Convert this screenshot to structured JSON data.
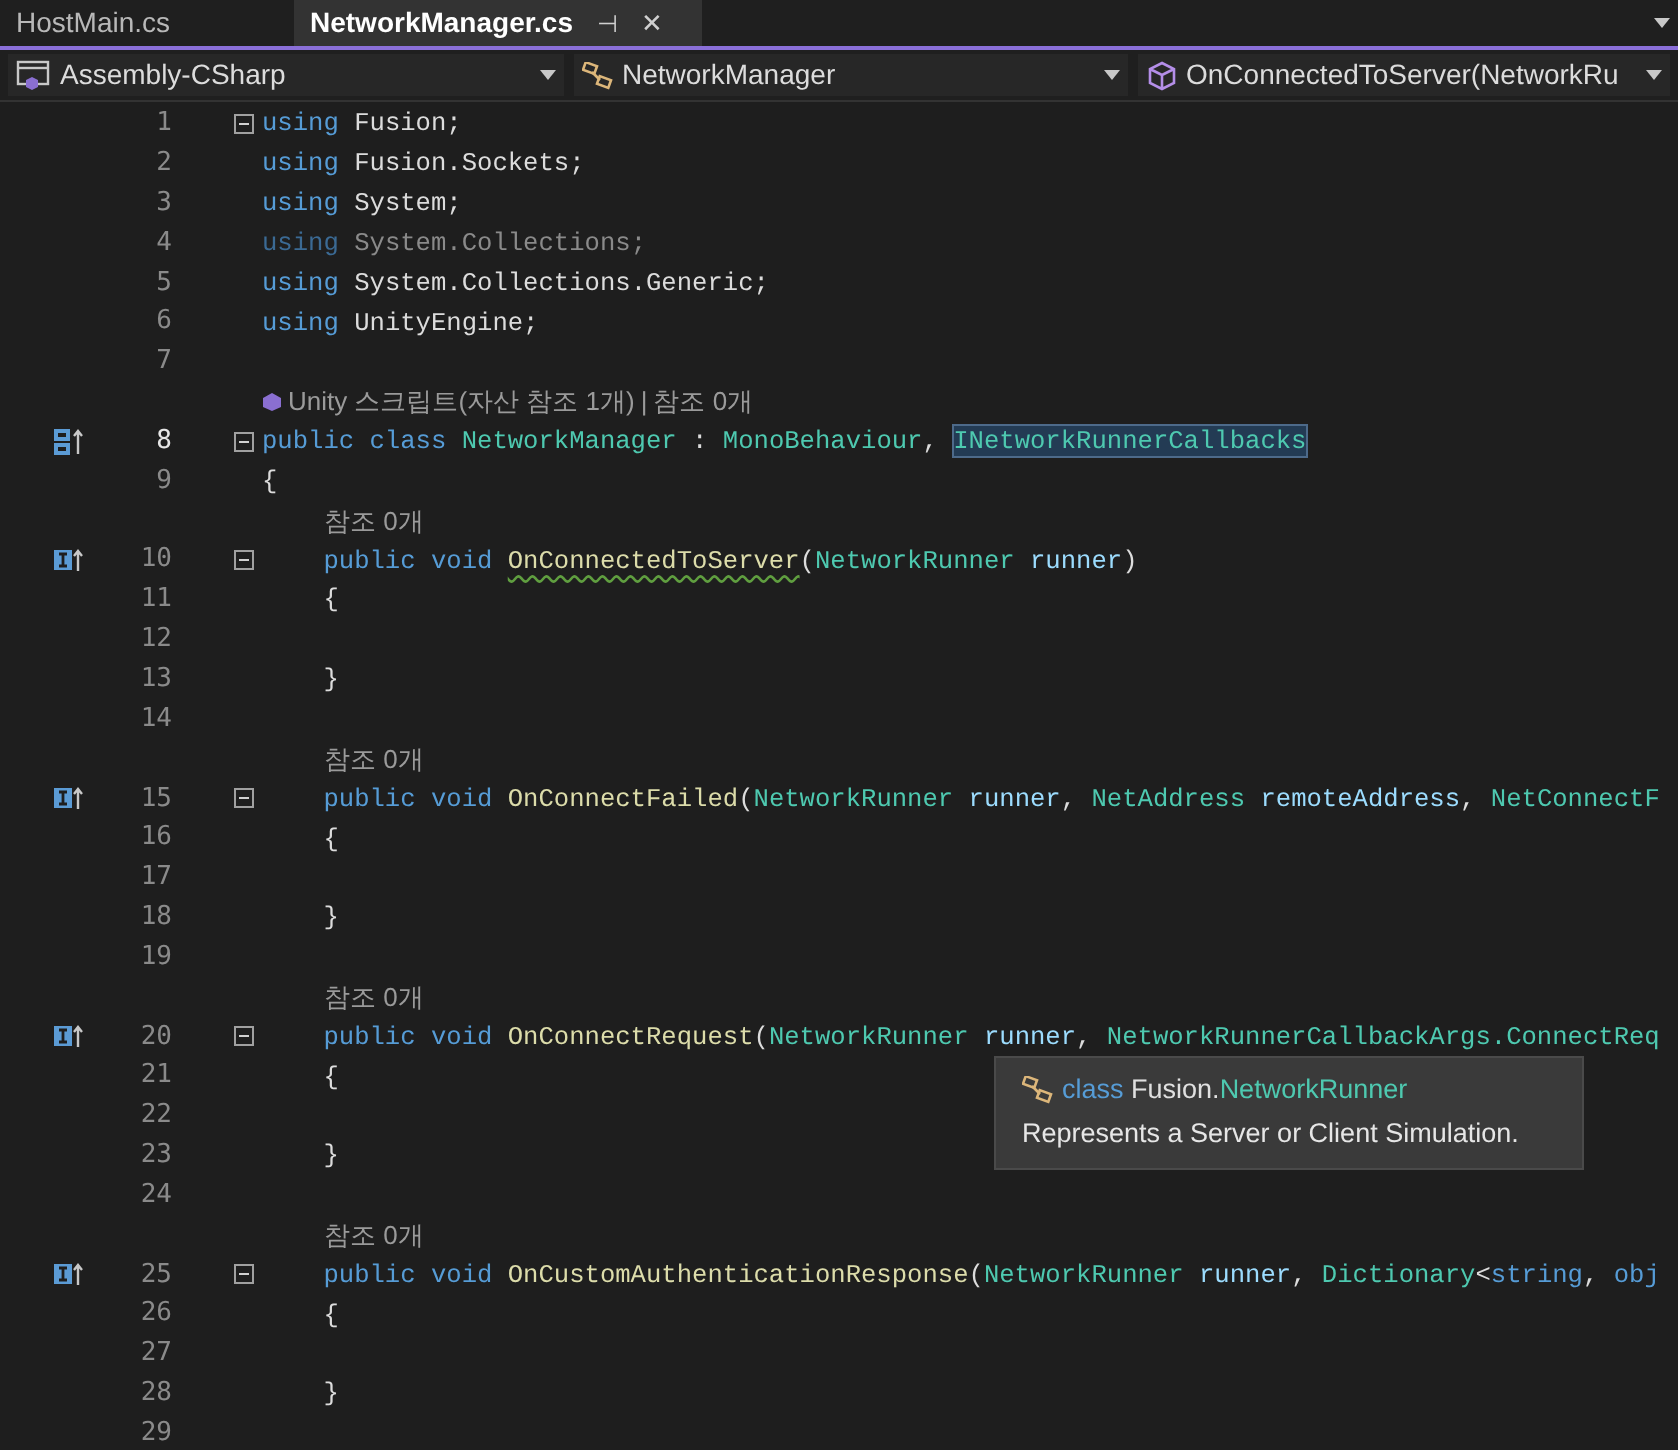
{
  "tabs": [
    {
      "label": "HostMain.cs",
      "selected": false
    },
    {
      "label": "NetworkManager.cs",
      "selected": true,
      "pin": "⊣",
      "close": "✕"
    }
  ],
  "nav": [
    {
      "kind": "project",
      "label": "Assembly-CSharp"
    },
    {
      "kind": "class",
      "label": "NetworkManager"
    },
    {
      "kind": "member",
      "label": "OnConnectedToServer(NetworkRu"
    }
  ],
  "lines": [
    {
      "kind": "code",
      "number": "1",
      "foldable": true,
      "current": false,
      "tokens": [
        {
          "t": "using",
          "kind": "kw"
        },
        {
          "t": " Fusion;",
          "kind": "plain"
        }
      ]
    },
    {
      "kind": "code",
      "number": "2",
      "foldable": false,
      "current": false,
      "tokens": [
        {
          "t": "using",
          "kind": "kw"
        },
        {
          "t": " Fusion.Sockets;",
          "kind": "plain"
        }
      ]
    },
    {
      "kind": "code",
      "number": "3",
      "foldable": false,
      "current": false,
      "tokens": [
        {
          "t": "using",
          "kind": "kw"
        },
        {
          "t": " System;",
          "kind": "plain"
        }
      ]
    },
    {
      "kind": "code",
      "number": "4",
      "foldable": false,
      "current": false,
      "tokens": [
        {
          "t": "using",
          "kind": "kw-dim"
        },
        {
          "t": " System.Collections;",
          "kind": "plain-dim"
        }
      ]
    },
    {
      "kind": "code",
      "number": "5",
      "foldable": false,
      "current": false,
      "tokens": [
        {
          "t": "using",
          "kind": "kw"
        },
        {
          "t": " System.Collections.Generic;",
          "kind": "plain"
        }
      ]
    },
    {
      "kind": "code",
      "number": "6",
      "foldable": false,
      "current": false,
      "tokens": [
        {
          "t": "using",
          "kind": "kw"
        },
        {
          "t": " UnityEngine;",
          "kind": "plain"
        }
      ]
    },
    {
      "kind": "code",
      "number": "7",
      "foldable": false,
      "current": false
    },
    {
      "kind": "lens",
      "indented": false,
      "unity_icon": true,
      "parts": [
        "Unity 스크립트(자산 참조 1개)",
        "|",
        "참조 0개"
      ]
    },
    {
      "kind": "code",
      "number": "8",
      "foldable": true,
      "current": true,
      "gutter": {
        "kind": "class-impl"
      },
      "tokens": [
        {
          "t": "public class",
          "kind": "kw"
        },
        {
          "t": " NetworkManager",
          "kind": "type"
        },
        {
          "t": " : ",
          "kind": "plain"
        },
        {
          "t": "MonoBehaviour",
          "kind": "type"
        },
        {
          "t": ", ",
          "kind": "plain"
        },
        {
          "t": "INetworkRunnerCallbacks",
          "kind": "type-hl"
        }
      ]
    },
    {
      "kind": "code",
      "number": "9",
      "foldable": false,
      "current": false,
      "tokens": [
        {
          "t": "{",
          "kind": "plain"
        }
      ]
    },
    {
      "kind": "lens",
      "indented": true,
      "unity_icon": false,
      "parts": [
        "참조 0개"
      ]
    },
    {
      "kind": "code",
      "number": "10",
      "foldable": true,
      "current": false,
      "gutter": {
        "kind": "impl"
      },
      "tokens": [
        {
          "t": "    public void ",
          "kind": "kw"
        },
        {
          "t": "OnConnectedToServer",
          "kind": "method-warn"
        },
        {
          "t": "(",
          "kind": "plain"
        },
        {
          "t": "NetworkRunner",
          "kind": "type"
        },
        {
          "t": " runner",
          "kind": "param"
        },
        {
          "t": ")",
          "kind": "plain"
        }
      ]
    },
    {
      "kind": "code",
      "number": "11",
      "foldable": false,
      "current": false,
      "tokens": [
        {
          "t": "    {",
          "kind": "plain"
        }
      ]
    },
    {
      "kind": "code",
      "number": "12",
      "foldable": false,
      "current": false
    },
    {
      "kind": "code",
      "number": "13",
      "foldable": false,
      "current": false,
      "tokens": [
        {
          "t": "    }",
          "kind": "plain"
        }
      ]
    },
    {
      "kind": "code",
      "number": "14",
      "foldable": false,
      "current": false
    },
    {
      "kind": "lens",
      "indented": true,
      "unity_icon": false,
      "parts": [
        "참조 0개"
      ]
    },
    {
      "kind": "code",
      "number": "15",
      "foldable": true,
      "current": false,
      "gutter": {
        "kind": "impl"
      },
      "tokens": [
        {
          "t": "    public void ",
          "kind": "kw"
        },
        {
          "t": "OnConnectFailed",
          "kind": "method"
        },
        {
          "t": "(",
          "kind": "plain"
        },
        {
          "t": "NetworkRunner",
          "kind": "type"
        },
        {
          "t": " runner",
          "kind": "param"
        },
        {
          "t": ", ",
          "kind": "plain"
        },
        {
          "t": "NetAddress",
          "kind": "type"
        },
        {
          "t": " remoteAddress",
          "kind": "param"
        },
        {
          "t": ", ",
          "kind": "plain"
        },
        {
          "t": "NetConnectF",
          "kind": "type"
        }
      ]
    },
    {
      "kind": "code",
      "number": "16",
      "foldable": false,
      "current": false,
      "tokens": [
        {
          "t": "    {",
          "kind": "plain"
        }
      ]
    },
    {
      "kind": "code",
      "number": "17",
      "foldable": false,
      "current": false
    },
    {
      "kind": "code",
      "number": "18",
      "foldable": false,
      "current": false,
      "tokens": [
        {
          "t": "    }",
          "kind": "plain"
        }
      ]
    },
    {
      "kind": "code",
      "number": "19",
      "foldable": false,
      "current": false
    },
    {
      "kind": "lens",
      "indented": true,
      "unity_icon": false,
      "parts": [
        "참조 0개"
      ]
    },
    {
      "kind": "code",
      "number": "20",
      "foldable": true,
      "current": false,
      "gutter": {
        "kind": "impl"
      },
      "tokens": [
        {
          "t": "    public void ",
          "kind": "kw"
        },
        {
          "t": "OnConnectRequest",
          "kind": "method"
        },
        {
          "t": "(",
          "kind": "plain"
        },
        {
          "t": "NetworkRunner",
          "kind": "type"
        },
        {
          "t": " runner",
          "kind": "param"
        },
        {
          "t": ", ",
          "kind": "plain"
        },
        {
          "t": "NetworkRunnerCallbackArgs.ConnectReq",
          "kind": "type"
        }
      ]
    },
    {
      "kind": "code",
      "number": "21",
      "foldable": false,
      "current": false,
      "tokens": [
        {
          "t": "    {",
          "kind": "plain"
        }
      ]
    },
    {
      "kind": "code",
      "number": "22",
      "foldable": false,
      "current": false
    },
    {
      "kind": "code",
      "number": "23",
      "foldable": false,
      "current": false,
      "tokens": [
        {
          "t": "    }",
          "kind": "plain"
        }
      ]
    },
    {
      "kind": "code",
      "number": "24",
      "foldable": false,
      "current": false
    },
    {
      "kind": "lens",
      "indented": true,
      "unity_icon": false,
      "parts": [
        "참조 0개"
      ]
    },
    {
      "kind": "code",
      "number": "25",
      "foldable": true,
      "current": false,
      "gutter": {
        "kind": "impl"
      },
      "tokens": [
        {
          "t": "    public void ",
          "kind": "kw"
        },
        {
          "t": "OnCustomAuthenticationResponse",
          "kind": "method"
        },
        {
          "t": "(",
          "kind": "plain"
        },
        {
          "t": "NetworkRunner",
          "kind": "type"
        },
        {
          "t": " runner",
          "kind": "param"
        },
        {
          "t": ", ",
          "kind": "plain"
        },
        {
          "t": "Dictionary",
          "kind": "type"
        },
        {
          "t": "<",
          "kind": "plain"
        },
        {
          "t": "string",
          "kind": "kw"
        },
        {
          "t": ", ",
          "kind": "plain"
        },
        {
          "t": "obj",
          "kind": "kw"
        }
      ]
    },
    {
      "kind": "code",
      "number": "26",
      "foldable": false,
      "current": false,
      "tokens": [
        {
          "t": "    {",
          "kind": "plain"
        }
      ]
    },
    {
      "kind": "code",
      "number": "27",
      "foldable": false,
      "current": false
    },
    {
      "kind": "code",
      "number": "28",
      "foldable": false,
      "current": false,
      "tokens": [
        {
          "t": "    }",
          "kind": "plain"
        }
      ]
    },
    {
      "kind": "code",
      "number": "29",
      "foldable": false,
      "current": false
    }
  ],
  "tooltip": {
    "keyword": "class",
    "namespace": "Fusion.",
    "type": "NetworkRunner",
    "description": "Represents a Server or Client Simulation."
  }
}
